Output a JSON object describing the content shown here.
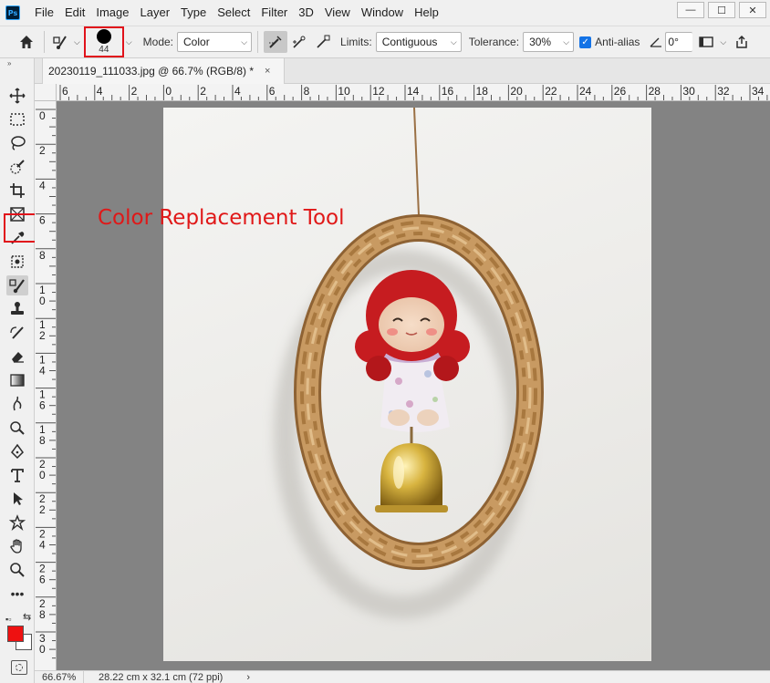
{
  "app": {
    "logo": "Ps"
  },
  "menu": [
    "File",
    "Edit",
    "Image",
    "Layer",
    "Type",
    "Select",
    "Filter",
    "3D",
    "View",
    "Window",
    "Help"
  ],
  "window_controls": {
    "minimize": "—",
    "maximize": "☐",
    "close": "✕"
  },
  "options_bar": {
    "brush_size": "44",
    "mode_label": "Mode:",
    "mode_value": "Color",
    "limits_label": "Limits:",
    "limits_value": "Contiguous",
    "tolerance_label": "Tolerance:",
    "tolerance_value": "30%",
    "antialias_label": "Anti-alias",
    "antialias_checked": true,
    "angle_value": "0°"
  },
  "document_tab": {
    "title": "20230119_111033.jpg @ 66.7% (RGB/8) *",
    "close": "×"
  },
  "ruler_h_labels": [
    "6",
    "4",
    "2",
    "0",
    "2",
    "4",
    "6",
    "8",
    "10",
    "12",
    "14",
    "16",
    "18",
    "20",
    "22",
    "24",
    "26",
    "28",
    "30",
    "32",
    "34"
  ],
  "ruler_v_labels": [
    "0",
    "2",
    "4",
    "6",
    "8",
    "10",
    "12",
    "14",
    "16",
    "18",
    "20",
    "22",
    "24",
    "26",
    "28",
    "30"
  ],
  "annotation": "Color Replacement Tool",
  "status": {
    "zoom": "66.67%",
    "doc_size": "28.22 cm x 32.1 cm (72 ppi)",
    "arrow": "›"
  },
  "colors": {
    "foreground": "#ee1111",
    "background": "#ffffff",
    "highlight": "#e1121b"
  },
  "tools": [
    "move-icon",
    "marquee-icon",
    "lasso-icon",
    "quick-selection-icon",
    "crop-icon",
    "frame-icon",
    "eyedropper-icon",
    "patch-icon",
    "color-replacement-icon",
    "clone-stamp-icon",
    "history-brush-icon",
    "eraser-icon",
    "gradient-icon",
    "smudge-icon",
    "dodge-icon",
    "pen-icon",
    "type-icon",
    "path-selection-icon",
    "custom-shape-icon",
    "hand-icon",
    "zoom-icon",
    "more-tools-icon"
  ]
}
